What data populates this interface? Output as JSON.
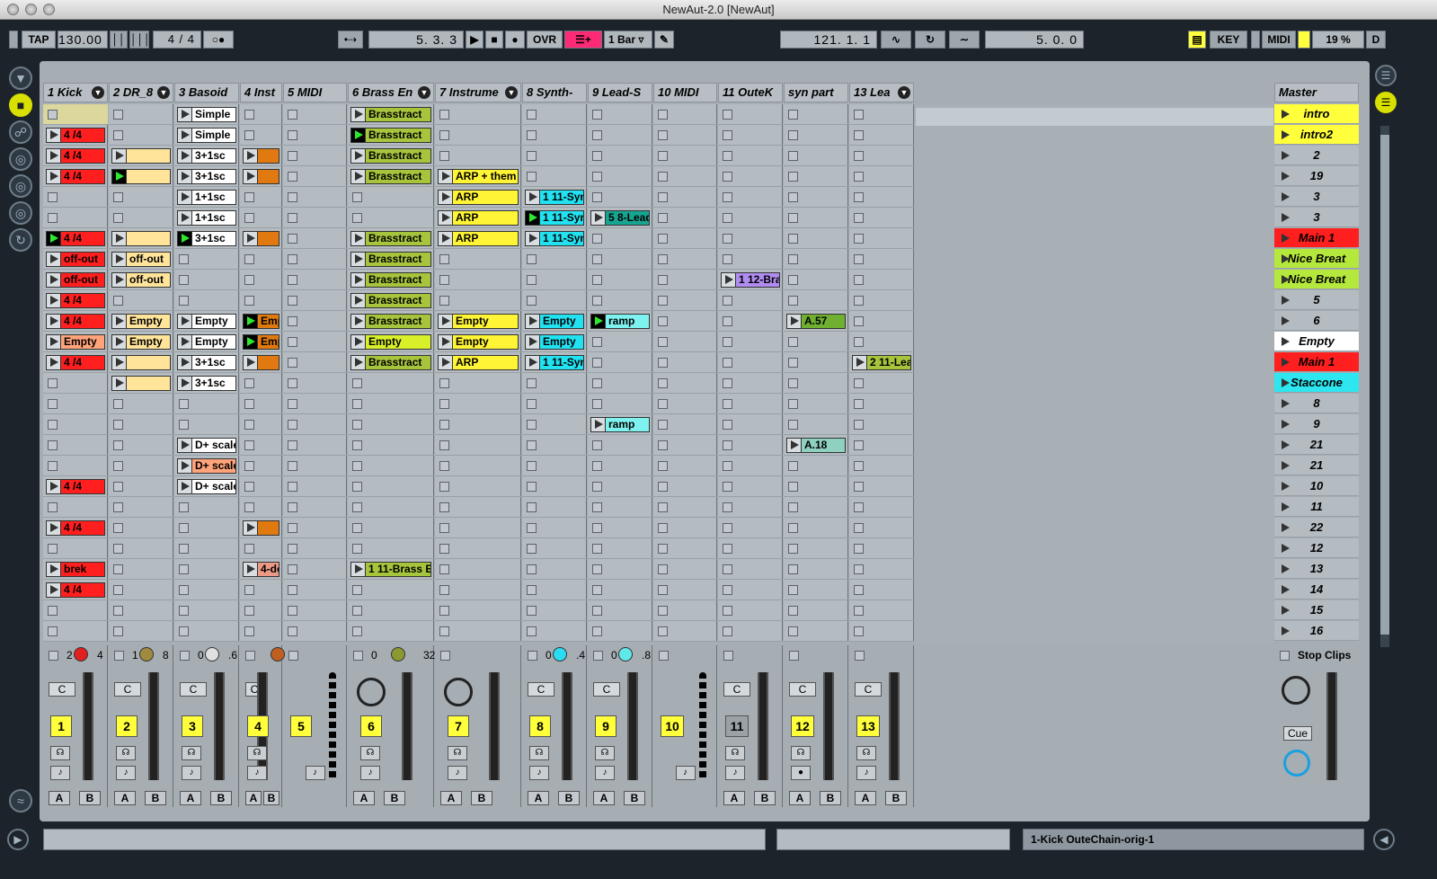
{
  "window": {
    "title": "NewAut-2.0  [NewAut]"
  },
  "controlbar": {
    "tap": "TAP",
    "tempo": "130.00",
    "signature": "4  /  4",
    "arrangement_position": "5.   3.   3",
    "ovr": "OVR",
    "quantize": "1 Bar",
    "loop_start": "121.   1.   1",
    "loop_length": "5.   0.   0",
    "key": "KEY",
    "midi": "MIDI",
    "cpu": "19 %",
    "d": "D"
  },
  "tracks": [
    {
      "name": "1 Kick"
    },
    {
      "name": "2 DR_8"
    },
    {
      "name": "3 Basoid"
    },
    {
      "name": "4 Inst"
    },
    {
      "name": "5 MIDI"
    },
    {
      "name": "6 Brass En"
    },
    {
      "name": "7 Instrume"
    },
    {
      "name": "8 Synth-"
    },
    {
      "name": "9 Lead-S"
    },
    {
      "name": "10 MIDI"
    },
    {
      "name": "11 OuteK"
    },
    {
      "name": "syn part"
    },
    {
      "name": "13 Lea"
    }
  ],
  "master": {
    "name": "Master",
    "stop_clips": "Stop Clips",
    "cue": "Cue",
    "scenes": [
      "intro",
      "intro2",
      "2",
      "19",
      "3",
      "3",
      "Main 1",
      "Nice Breat",
      "Nice Breat",
      "5",
      "6",
      "Empty",
      "Main 1",
      "Staccone",
      "8",
      "9",
      "21",
      "21",
      "10",
      "11",
      "22",
      "12",
      "13",
      "14",
      "15",
      "16"
    ]
  },
  "clips": [
    {
      "t": 0,
      "r": 1,
      "label": "4 /4",
      "color": "#ff1f1f"
    },
    {
      "t": 0,
      "r": 2,
      "label": "4 /4",
      "color": "#ff1f1f"
    },
    {
      "t": 0,
      "r": 3,
      "label": "4 /4",
      "color": "#ff1f1f"
    },
    {
      "t": 0,
      "r": 6,
      "label": "4 /4",
      "color": "#ff1f1f",
      "playing": true
    },
    {
      "t": 0,
      "r": 7,
      "label": "off-out",
      "color": "#ff1f1f"
    },
    {
      "t": 0,
      "r": 8,
      "label": "off-out",
      "color": "#ff1f1f"
    },
    {
      "t": 0,
      "r": 9,
      "label": "4 /4",
      "color": "#ff1f1f"
    },
    {
      "t": 0,
      "r": 10,
      "label": "4 /4",
      "color": "#ff1f1f"
    },
    {
      "t": 0,
      "r": 11,
      "label": "Empty",
      "color": "#ffa37a"
    },
    {
      "t": 0,
      "r": 12,
      "label": "4 /4",
      "color": "#ff1f1f"
    },
    {
      "t": 0,
      "r": 18,
      "label": "4 /4",
      "color": "#ff1f1f"
    },
    {
      "t": 0,
      "r": 20,
      "label": "4 /4",
      "color": "#ff1f1f"
    },
    {
      "t": 0,
      "r": 22,
      "label": "brek",
      "color": "#ff1f1f"
    },
    {
      "t": 0,
      "r": 23,
      "label": "4 /4",
      "color": "#ff1f1f"
    },
    {
      "t": 1,
      "r": 2,
      "label": "",
      "color": "#ffe49a"
    },
    {
      "t": 1,
      "r": 3,
      "label": "",
      "color": "#ffe49a",
      "playing": true
    },
    {
      "t": 1,
      "r": 6,
      "label": "",
      "color": "#ffe49a"
    },
    {
      "t": 1,
      "r": 7,
      "label": "off-out",
      "color": "#ffe49a"
    },
    {
      "t": 1,
      "r": 8,
      "label": "off-out",
      "color": "#ffe49a"
    },
    {
      "t": 1,
      "r": 10,
      "label": "Empty",
      "color": "#ffe49a"
    },
    {
      "t": 1,
      "r": 11,
      "label": "Empty",
      "color": "#ffe49a"
    },
    {
      "t": 1,
      "r": 12,
      "label": "",
      "color": "#ffe49a"
    },
    {
      "t": 1,
      "r": 13,
      "label": "",
      "color": "#ffe49a"
    },
    {
      "t": 2,
      "r": 0,
      "label": "Simple",
      "color": "#ffffff"
    },
    {
      "t": 2,
      "r": 1,
      "label": "Simple",
      "color": "#ffffff"
    },
    {
      "t": 2,
      "r": 2,
      "label": "3+1sc",
      "color": "#ffffff"
    },
    {
      "t": 2,
      "r": 3,
      "label": "3+1sc",
      "color": "#ffffff"
    },
    {
      "t": 2,
      "r": 4,
      "label": "1+1sc",
      "color": "#ffffff"
    },
    {
      "t": 2,
      "r": 5,
      "label": "1+1sc",
      "color": "#ffffff"
    },
    {
      "t": 2,
      "r": 6,
      "label": "3+1sc",
      "color": "#ffffff",
      "playing": true
    },
    {
      "t": 2,
      "r": 10,
      "label": "Empty",
      "color": "#ffffff"
    },
    {
      "t": 2,
      "r": 11,
      "label": "Empty",
      "color": "#ffffff"
    },
    {
      "t": 2,
      "r": 12,
      "label": "3+1sc",
      "color": "#ffffff"
    },
    {
      "t": 2,
      "r": 13,
      "label": "3+1sc",
      "color": "#ffffff"
    },
    {
      "t": 2,
      "r": 16,
      "label": "D+ scale",
      "color": "#ffffff"
    },
    {
      "t": 2,
      "r": 17,
      "label": "D+ scale",
      "color": "#ffa37a"
    },
    {
      "t": 2,
      "r": 18,
      "label": "D+ scale",
      "color": "#ffffff"
    },
    {
      "t": 3,
      "r": 2,
      "label": "",
      "color": "#e07a10"
    },
    {
      "t": 3,
      "r": 3,
      "label": "",
      "color": "#e07a10"
    },
    {
      "t": 3,
      "r": 6,
      "label": "",
      "color": "#e07a10"
    },
    {
      "t": 3,
      "r": 10,
      "label": "Emp",
      "color": "#e07a10",
      "playing": true
    },
    {
      "t": 3,
      "r": 11,
      "label": "Emp",
      "color": "#e07a10",
      "playing": true
    },
    {
      "t": 3,
      "r": 12,
      "label": "",
      "color": "#e07a10"
    },
    {
      "t": 3,
      "r": 20,
      "label": "",
      "color": "#e07a10"
    },
    {
      "t": 3,
      "r": 22,
      "label": "4-de",
      "color": "#ec9a86"
    },
    {
      "t": 5,
      "r": 0,
      "label": "Brasstract",
      "color": "#a6c43c"
    },
    {
      "t": 5,
      "r": 1,
      "label": "Brasstract",
      "color": "#a6c43c",
      "playing": true
    },
    {
      "t": 5,
      "r": 2,
      "label": "Brasstract",
      "color": "#a6c43c"
    },
    {
      "t": 5,
      "r": 3,
      "label": "Brasstract",
      "color": "#a6c43c"
    },
    {
      "t": 5,
      "r": 6,
      "label": "Brasstract",
      "color": "#a6c43c"
    },
    {
      "t": 5,
      "r": 7,
      "label": "Brasstract",
      "color": "#a6c43c"
    },
    {
      "t": 5,
      "r": 8,
      "label": "Brasstract",
      "color": "#a6c43c"
    },
    {
      "t": 5,
      "r": 9,
      "label": "Brasstract",
      "color": "#a6c43c"
    },
    {
      "t": 5,
      "r": 10,
      "label": "Brasstract",
      "color": "#a6c43c"
    },
    {
      "t": 5,
      "r": 11,
      "label": "Empty",
      "color": "#d8f02a"
    },
    {
      "t": 5,
      "r": 12,
      "label": "Brasstract",
      "color": "#a6c43c"
    },
    {
      "t": 5,
      "r": 22,
      "label": "1 11-Brass E",
      "color": "#a6c43c"
    },
    {
      "t": 6,
      "r": 3,
      "label": "ARP + them",
      "color": "#fff536"
    },
    {
      "t": 6,
      "r": 4,
      "label": "ARP",
      "color": "#fff536"
    },
    {
      "t": 6,
      "r": 5,
      "label": "ARP",
      "color": "#fff536"
    },
    {
      "t": 6,
      "r": 6,
      "label": "ARP",
      "color": "#fff536"
    },
    {
      "t": 6,
      "r": 10,
      "label": "Empty",
      "color": "#fff536"
    },
    {
      "t": 6,
      "r": 11,
      "label": "Empty",
      "color": "#fff536"
    },
    {
      "t": 6,
      "r": 12,
      "label": "ARP",
      "color": "#fff536"
    },
    {
      "t": 7,
      "r": 4,
      "label": "1 11-Syn",
      "color": "#22e2f2"
    },
    {
      "t": 7,
      "r": 5,
      "label": "1 11-Syn",
      "color": "#22e2f2",
      "playing": true
    },
    {
      "t": 7,
      "r": 6,
      "label": "1 11-Syn",
      "color": "#22e2f2"
    },
    {
      "t": 7,
      "r": 10,
      "label": "Empty",
      "color": "#22e2f2"
    },
    {
      "t": 7,
      "r": 11,
      "label": "Empty",
      "color": "#22e2f2"
    },
    {
      "t": 7,
      "r": 12,
      "label": "1 11-Syn",
      "color": "#22e2f2"
    },
    {
      "t": 8,
      "r": 5,
      "label": "5 8-Lead",
      "color": "#17a592"
    },
    {
      "t": 8,
      "r": 10,
      "label": "ramp",
      "color": "#7ef2ee",
      "playing": true
    },
    {
      "t": 8,
      "r": 15,
      "label": "ramp",
      "color": "#7ef2ee"
    },
    {
      "t": 10,
      "r": 8,
      "label": "1 12-Bra",
      "color": "#b08cf0"
    },
    {
      "t": 11,
      "r": 10,
      "label": "A.57",
      "color": "#6fb030"
    },
    {
      "t": 11,
      "r": 16,
      "label": "A.18",
      "color": "#8fd0c0"
    },
    {
      "t": 12,
      "r": 12,
      "label": "2 11-Lea",
      "color": "#a6c43c"
    }
  ],
  "mixer": [
    {
      "n": "1",
      "sends": "2",
      "v": "4"
    },
    {
      "n": "2",
      "sends": "1",
      "v": "8"
    },
    {
      "n": "3",
      "sends": "0",
      "v": ".6"
    },
    {
      "n": "4",
      "sends": "",
      "v": ""
    },
    {
      "n": "5",
      "sends": "",
      "v": ""
    },
    {
      "n": "6",
      "sends": "0",
      "v": "32"
    },
    {
      "n": "7",
      "sends": "",
      "v": ""
    },
    {
      "n": "8",
      "sends": "0",
      "v": ".4"
    },
    {
      "n": "9",
      "sends": "0",
      "v": ".8"
    },
    {
      "n": "10",
      "sends": "",
      "v": ""
    },
    {
      "n": "11",
      "sends": "",
      "v": ""
    },
    {
      "n": "12",
      "sends": "",
      "v": ""
    },
    {
      "n": "13",
      "sends": "",
      "v": ""
    }
  ],
  "bottom": {
    "chain": "1-Kick OuteChain-orig-1"
  },
  "labels": {
    "c": "C",
    "a": "A",
    "b": "B"
  }
}
